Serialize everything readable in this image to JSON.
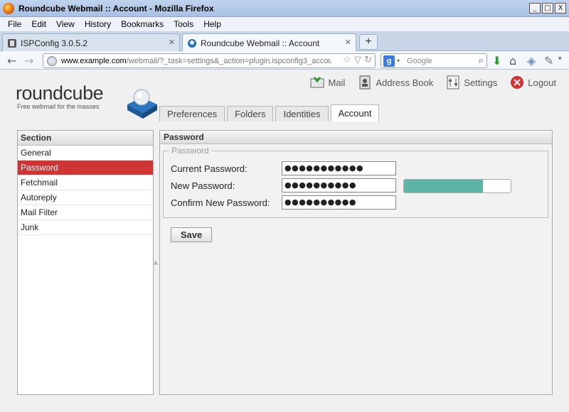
{
  "window": {
    "title": "Roundcube Webmail :: Account - Mozilla Firefox",
    "min": "_",
    "max": "□",
    "close": "X"
  },
  "menu": [
    "File",
    "Edit",
    "View",
    "History",
    "Bookmarks",
    "Tools",
    "Help"
  ],
  "tabs": [
    {
      "label": "ISPConfig 3.0.5.2",
      "close": "✕"
    },
    {
      "label": "Roundcube Webmail :: Account",
      "close": "✕"
    }
  ],
  "newtab_label": "+",
  "url": {
    "host": "www.example.com",
    "path": "/webmail/?_task=settings&_action=plugin.ispconfig3_accou"
  },
  "search": {
    "placeholder": "Google"
  },
  "logo": {
    "word": "roundcube",
    "tagline": "Free webmail for the masses"
  },
  "topnav": {
    "mail": "Mail",
    "address_book": "Address Book",
    "settings": "Settings",
    "logout": "Logout"
  },
  "settings_tabs": [
    "Preferences",
    "Folders",
    "Identities",
    "Account"
  ],
  "sidebar": {
    "header": "Section",
    "items": [
      "General",
      "Password",
      "Fetchmail",
      "Autoreply",
      "Mail Filter",
      "Junk"
    ],
    "selected": "Password"
  },
  "main": {
    "header": "Password",
    "legend": "Password",
    "current_label": "Current Password:",
    "current_value": "●●●●●●●●●●●",
    "new_label": "New Password:",
    "new_value": "●●●●●●●●●●",
    "confirm_label": "Confirm New Password:",
    "confirm_value": "●●●●●●●●●●",
    "strength_fraction": 0.74,
    "save_label": "Save"
  },
  "colors": {
    "selection": "#cf3535",
    "strength": "#5db5a6"
  }
}
